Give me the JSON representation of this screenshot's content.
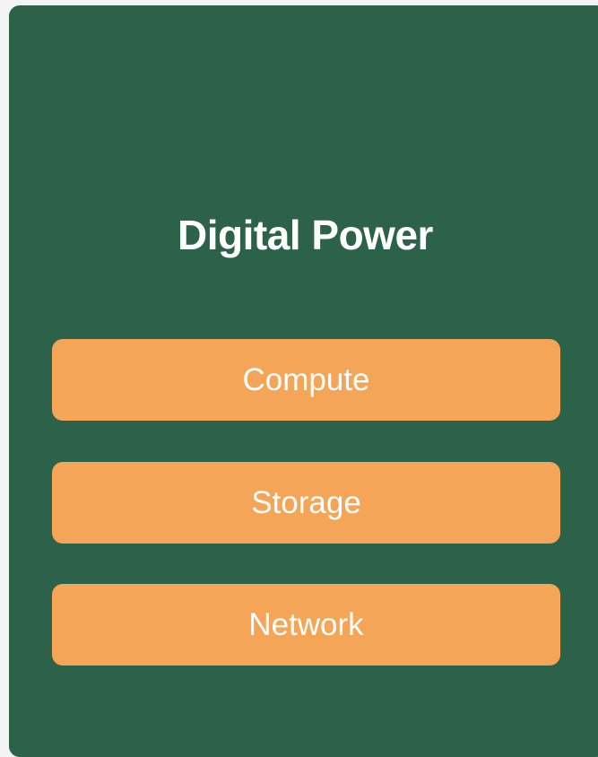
{
  "card": {
    "title": "Digital Power",
    "options": [
      {
        "label": "Compute"
      },
      {
        "label": "Storage"
      },
      {
        "label": "Network"
      }
    ]
  },
  "colors": {
    "card_background": "#2c624a",
    "button_background": "#f4a557",
    "text": "#ffffff"
  }
}
